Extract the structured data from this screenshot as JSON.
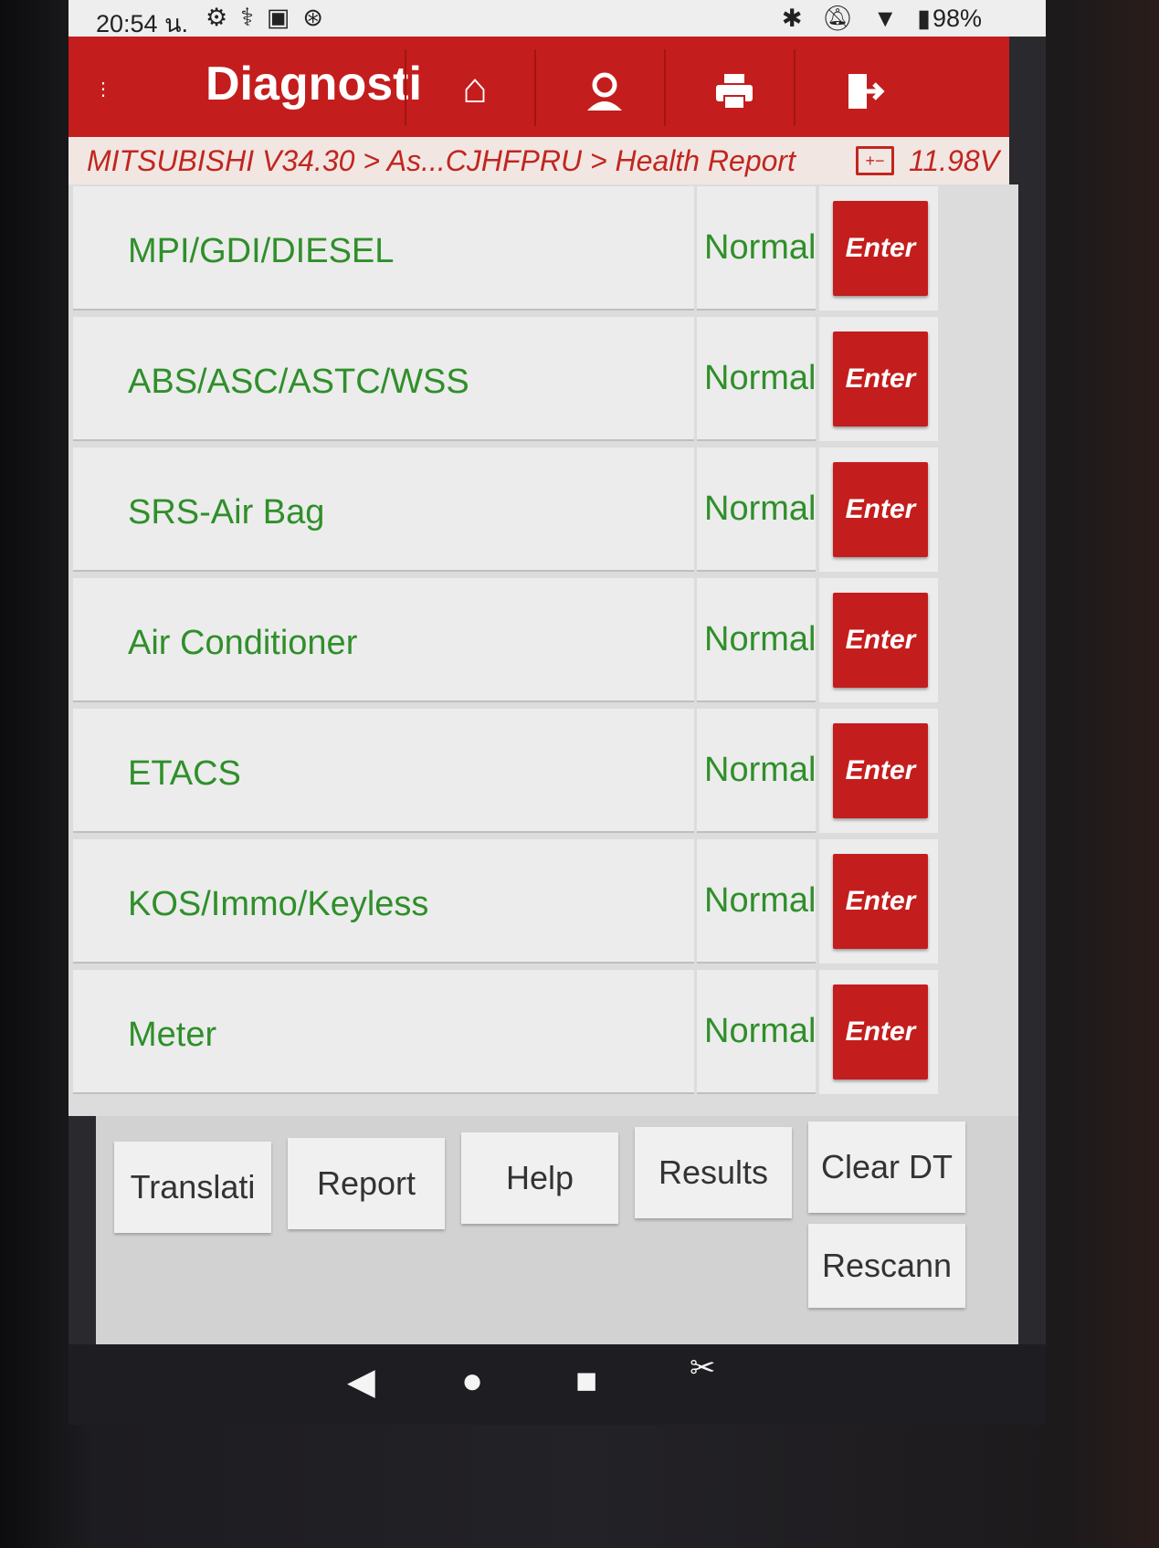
{
  "status_bar": {
    "time": "20:54 น.",
    "left_icons": [
      "gear-icon",
      "stethoscope-icon",
      "image-icon",
      "bluetooth-circle-icon"
    ],
    "right_icons": [
      "bluetooth-icon",
      "mute-icon",
      "wifi-icon"
    ],
    "battery": "98%"
  },
  "header": {
    "title": "Diagnosti",
    "buttons": [
      "home-icon",
      "user-icon",
      "printer-icon",
      "exit-icon"
    ]
  },
  "breadcrumb": {
    "path": "MITSUBISHI V34.30 > As...CJHFPRU > Health Report",
    "voltage": "11.98V"
  },
  "systems": [
    {
      "name": "MPI/GDI/DIESEL",
      "status": "Normal",
      "action": "Enter"
    },
    {
      "name": "ABS/ASC/ASTC/WSS",
      "status": "Normal",
      "action": "Enter"
    },
    {
      "name": "SRS-Air Bag",
      "status": "Normal",
      "action": "Enter"
    },
    {
      "name": "Air Conditioner",
      "status": "Normal",
      "action": "Enter"
    },
    {
      "name": "ETACS",
      "status": "Normal",
      "action": "Enter"
    },
    {
      "name": "KOS/Immo/Keyless",
      "status": "Normal",
      "action": "Enter"
    },
    {
      "name": "Meter",
      "status": "Normal",
      "action": "Enter"
    }
  ],
  "toolbar": {
    "translation": "Translati",
    "report": "Report",
    "help": "Help",
    "results": "Results",
    "clear_dtc": "Clear DT",
    "rescan": "Rescann"
  },
  "colors": {
    "header": "#c41d1d",
    "status_text": "#2f8f2a",
    "breadcrumb_text": "#c0261f"
  }
}
